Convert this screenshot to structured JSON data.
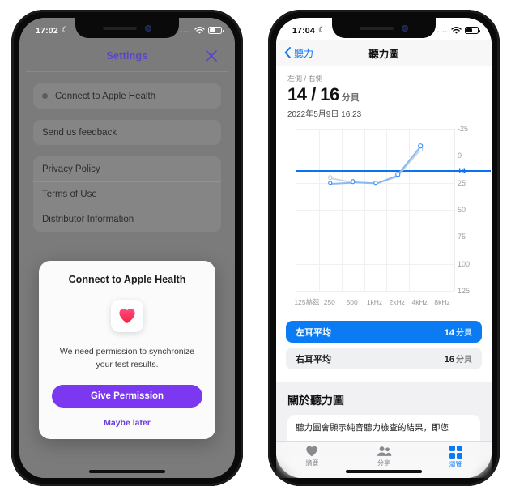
{
  "left_phone": {
    "status_bar": {
      "time": "17:02",
      "moon_icon": "moon-icon",
      "wifi_icon": "wifi-icon",
      "battery_icon": "battery-icon",
      "dots": "...."
    },
    "settings": {
      "title": "Settings",
      "close_icon": "close-icon",
      "groups": [
        {
          "items": [
            {
              "label": "Connect to Apple Health",
              "has_dot": true
            }
          ]
        },
        {
          "items": [
            {
              "label": "Send us feedback",
              "has_dot": false
            }
          ]
        },
        {
          "items": [
            {
              "label": "Privacy Policy",
              "has_dot": false
            },
            {
              "label": "Terms of Use",
              "has_dot": false
            },
            {
              "label": "Distributor Information",
              "has_dot": false
            }
          ]
        }
      ]
    },
    "dialog": {
      "title": "Connect to Apple Health",
      "icon": "heart-icon",
      "body": "We need permission to synchronize your test results.",
      "primary_button": "Give Permission",
      "secondary_link": "Maybe later",
      "primary_color": "#7b38f0",
      "link_color": "#6a3fe0"
    }
  },
  "right_phone": {
    "status_bar": {
      "time": "17:04",
      "moon_icon": "moon-icon",
      "wifi_icon": "wifi-icon",
      "battery_icon": "battery-icon",
      "dots": "...."
    },
    "nav": {
      "back_label": "聽力",
      "back_icon": "chevron-left-icon",
      "title": "聽力圖"
    },
    "summary": {
      "ears_label": "左側 / 右側",
      "value": "14 / 16",
      "unit": "分貝",
      "datetime": "2022年5月9日  16:23"
    },
    "averages": [
      {
        "label": "左耳平均",
        "value": "14",
        "unit": "分貝",
        "highlight": true
      },
      {
        "label": "右耳平均",
        "value": "16",
        "unit": "分貝",
        "highlight": false
      }
    ],
    "about": {
      "heading": "關於聽力圖",
      "body": "聽力圖會顯示純音聽力檢查的結果，即您"
    },
    "tabs": [
      {
        "label": "摘要",
        "icon": "heart-icon",
        "active": false
      },
      {
        "label": "分享",
        "icon": "people-icon",
        "active": false
      },
      {
        "label": "瀏覽",
        "icon": "grid-icon",
        "active": true
      }
    ],
    "accent_color": "#0a7bf2"
  },
  "chart_data": {
    "type": "line",
    "title": "聽力圖",
    "xlabel": "",
    "ylabel": "",
    "grid": true,
    "legend_position": "none",
    "x": [
      "125赫茲",
      "250",
      "500",
      "1kHz",
      "2kHz",
      "4kHz",
      "8kHz"
    ],
    "categories": [
      "125赫茲",
      "250",
      "500",
      "1kHz",
      "2kHz",
      "4kHz",
      "8kHz"
    ],
    "ylim": [
      -25,
      125
    ],
    "y_ticks": [
      -25,
      0,
      25,
      50,
      75,
      100,
      125
    ],
    "y_inverted": true,
    "reference_line": {
      "value": 14,
      "label": "14",
      "color": "#0a74f0"
    },
    "series": [
      {
        "name": "左耳",
        "color": "#2b87f5",
        "style": "solid",
        "values": [
          null,
          25,
          24,
          25,
          17,
          -9,
          null
        ]
      },
      {
        "name": "右耳",
        "color": "#b9c8da",
        "style": "dashed",
        "values": [
          null,
          20,
          24,
          25,
          18,
          -6,
          null
        ]
      }
    ]
  }
}
